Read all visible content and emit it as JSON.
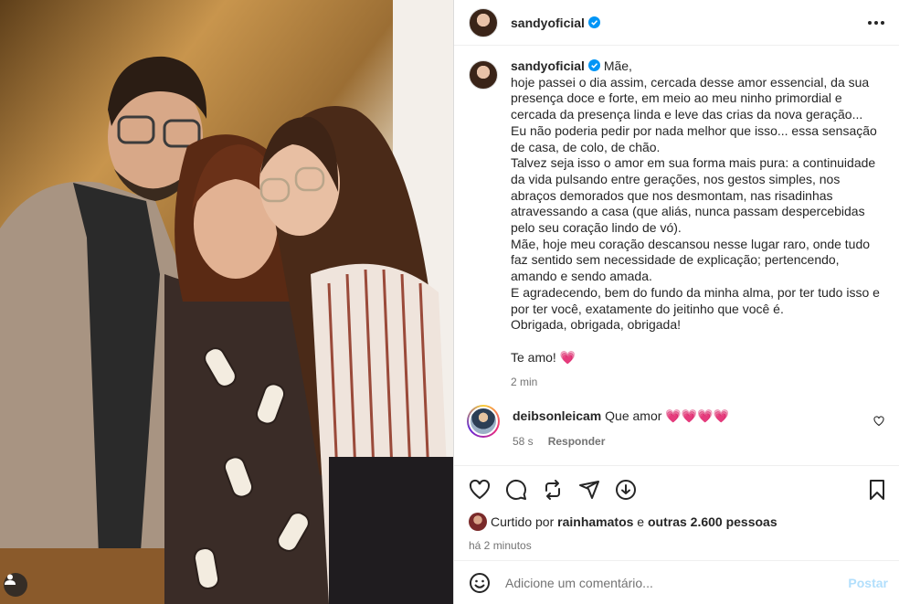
{
  "post": {
    "author": "sandyoficial",
    "verified": true
  },
  "caption": {
    "author": "sandyoficial",
    "text": "Mãe,\nhoje passei o dia assim, cercada desse amor essencial, da sua presença doce e forte, em meio ao meu ninho primordial e cercada da presença linda e leve das crias da nova geração...\nEu não poderia pedir por nada melhor que isso... essa sensação de casa, de colo, de chão.\nTalvez seja isso o amor em sua forma mais pura: a continuidade da vida pulsando entre gerações, nos gestos simples, nos abraços demorados que nos desmontam, nas risadinhas atravessando a casa (que aliás, nunca passam despercebidas pelo seu coração lindo de vó).\nMãe, hoje meu coração descansou nesse lugar raro, onde tudo faz sentido sem necessidade de explicação; pertencendo, amando e sendo amada.\nE agradecendo, bem do fundo da minha alma, por ter tudo isso e por ter você, exatamente do jeitinho que você é.\nObrigada, obrigada, obrigada!",
    "signoff": "Te amo!",
    "signoff_emoji": "💗",
    "time": "2 min"
  },
  "comments": [
    {
      "author": "deibsonleicam",
      "text": "Que amor",
      "emojis": "💗💗💗💗",
      "time": "58 s",
      "reply_label": "Responder"
    }
  ],
  "likes": {
    "prefix": "Curtido por",
    "first_user": "rainhamatos",
    "connector": "e",
    "others": "outras 2.600 pessoas"
  },
  "posted_ago": "há 2 minutos",
  "add_comment": {
    "placeholder": "Adicione um comentário...",
    "post_label": "Postar"
  },
  "icons": {
    "verified": "verified-badge-icon",
    "more": "more-options-icon",
    "like": "heart-icon",
    "comment": "comment-icon",
    "repost": "repost-icon",
    "share": "share-icon",
    "download": "download-icon",
    "save": "bookmark-icon",
    "emoji": "emoji-icon",
    "user_tag": "user-tag-icon"
  },
  "colors": {
    "accent": "#0095f6",
    "heart": "#ff2e7e",
    "post_button_disabled": "#b2dffc",
    "muted_text": "#737373"
  }
}
